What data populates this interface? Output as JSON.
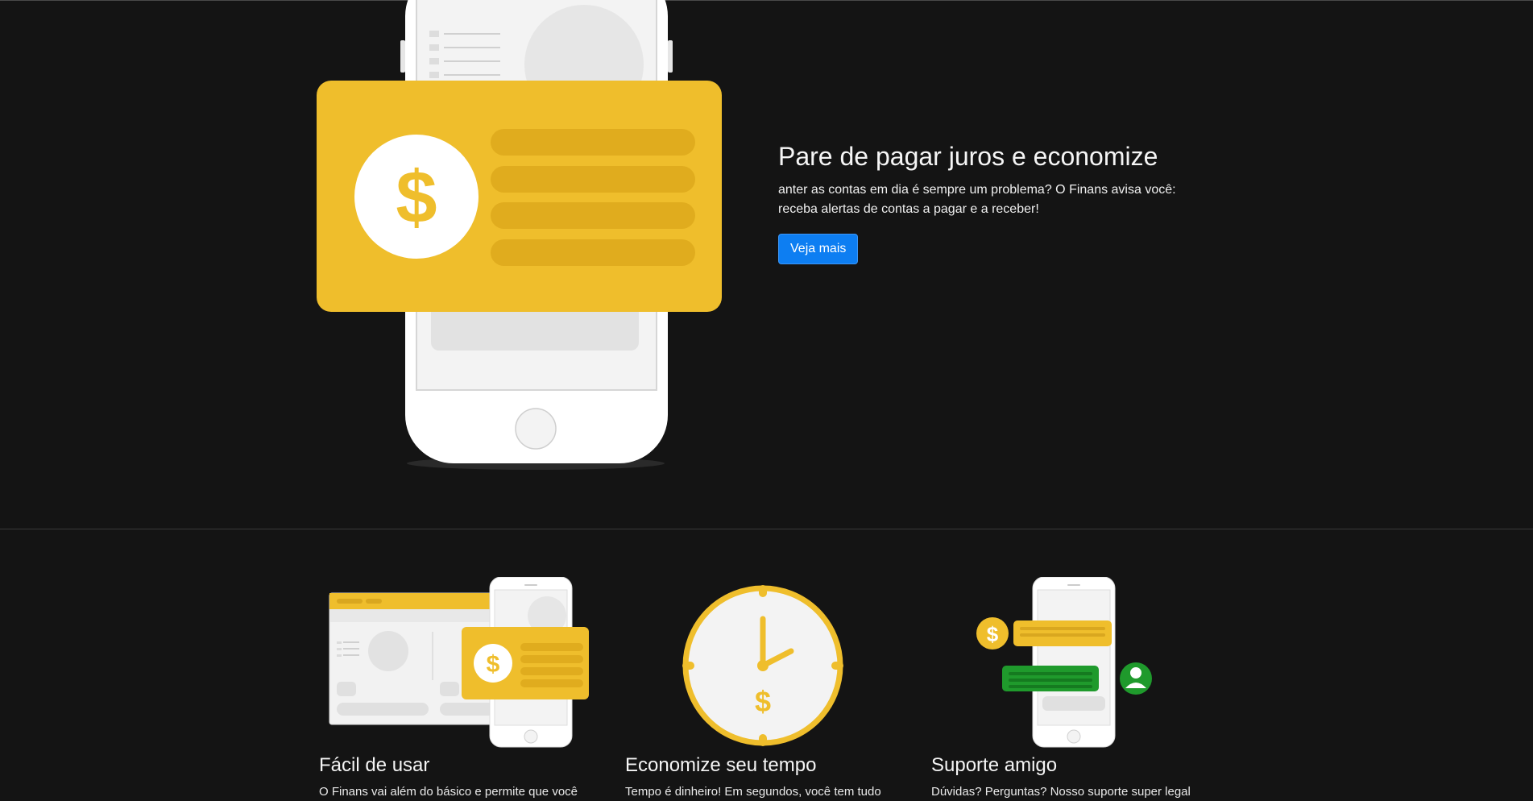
{
  "hero": {
    "title": "Pare de pagar juros e economize",
    "description": "anter as contas em dia é sempre um problema? O Finans avisa você: receba alertas de contas a pagar e a receber!",
    "cta_label": "Veja mais",
    "illustration_icon": "phone-with-dollar-card-icon"
  },
  "features": [
    {
      "title": "Fácil de usar",
      "text": "O Finans vai além do básico e permite que você",
      "icon": "desktop-and-phone-dollar-icon"
    },
    {
      "title": "Economize seu tempo",
      "text": "Tempo é dinheiro! Em segundos, você tem tudo",
      "icon": "clock-dollar-icon"
    },
    {
      "title": "Suporte amigo",
      "text": "Dúvidas? Perguntas? Nosso suporte super legal",
      "icon": "phone-chat-support-icon"
    }
  ],
  "colors": {
    "background": "#141414",
    "accent_yellow": "#efbe2c",
    "button_blue": "#0d7ef2",
    "support_green": "#1f9a2c"
  }
}
